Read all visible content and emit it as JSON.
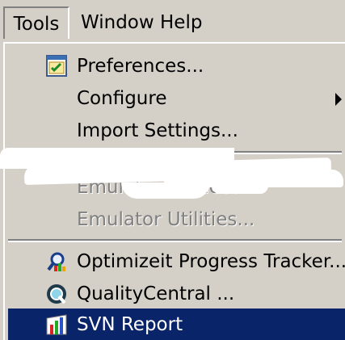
{
  "menubar": {
    "items": [
      {
        "label": "Tools",
        "active": true
      },
      {
        "label": "Window"
      },
      {
        "label": "Help"
      }
    ]
  },
  "menu": {
    "items": [
      {
        "label": "Preferences...",
        "icon": "preferences-checklist-icon"
      },
      {
        "label": "Configure",
        "submenu": true
      },
      {
        "label": "Import Settings..."
      },
      {
        "label": "Emulator Devices...",
        "disabled": true,
        "obscured": true
      },
      {
        "label": "Emulator Utilities...",
        "disabled": true
      },
      {
        "label": "Optimizeit Progress Tracker...",
        "icon": "progress-tracker-icon"
      },
      {
        "label": "QualityCentral ...",
        "icon": "qualitycentral-icon"
      },
      {
        "label": "SVN Report",
        "icon": "svn-report-icon",
        "highlighted": true
      }
    ]
  },
  "colors": {
    "menu_bg": "#d4d0c8",
    "highlight_bg": "#0a246a",
    "highlight_text": "#ffffff",
    "disabled_text": "#808080"
  }
}
